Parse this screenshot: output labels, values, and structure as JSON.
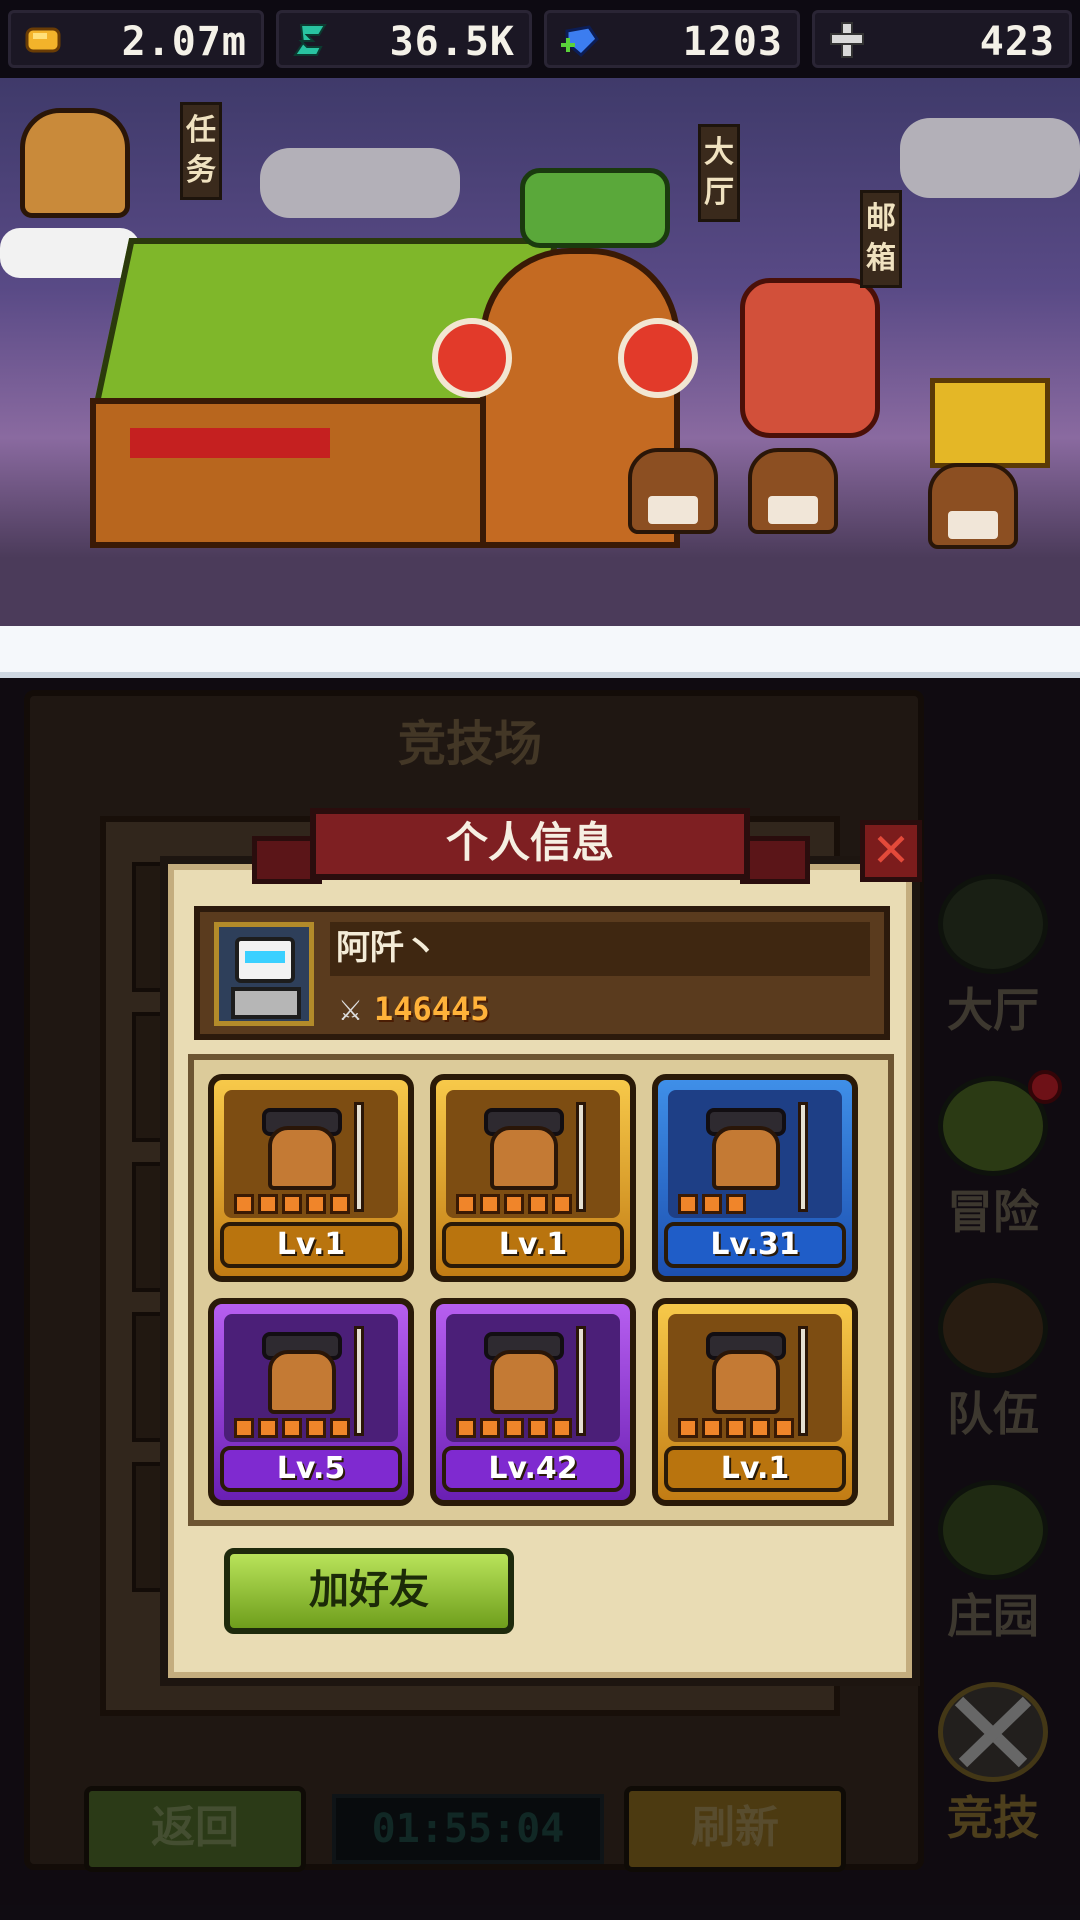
{
  "currencies": [
    {
      "name": "gold-coin-icon",
      "value": "2.07m",
      "color": "#f3b32a"
    },
    {
      "name": "energy-icon",
      "value": "36.5K",
      "color": "#29c3a1"
    },
    {
      "name": "gem-icon",
      "value": "1203",
      "color": "#3c7df0"
    },
    {
      "name": "cross-icon",
      "value": "423",
      "color": "#d9d9d9"
    }
  ],
  "town_signs": {
    "quest": "任务",
    "hall": "大厅",
    "mailbox": "邮箱"
  },
  "arena": {
    "title": "竞技场",
    "back_label": "返回",
    "timer": "01:55:04",
    "refresh_label": "刷新"
  },
  "side_nav": [
    {
      "label": "大厅",
      "icon": "hall-icon"
    },
    {
      "label": "冒险",
      "icon": "adventure-icon",
      "notify": true
    },
    {
      "label": "队伍",
      "icon": "team-icon"
    },
    {
      "label": "庄园",
      "icon": "manor-icon"
    },
    {
      "label": "竞技",
      "icon": "arena-swords-icon"
    }
  ],
  "dialog": {
    "title": "个人信息",
    "close_glyph": "✕",
    "player_name": "阿阡丶",
    "power_value": "146445",
    "add_friend_label": "加好友"
  },
  "heroes": [
    {
      "level": "Lv.1",
      "rarity": "gold",
      "stars": 5
    },
    {
      "level": "Lv.1",
      "rarity": "gold",
      "stars": 5
    },
    {
      "level": "Lv.31",
      "rarity": "blue",
      "stars": 3
    },
    {
      "level": "Lv.5",
      "rarity": "purple",
      "stars": 5
    },
    {
      "level": "Lv.42",
      "rarity": "purple",
      "stars": 5
    },
    {
      "level": "Lv.1",
      "rarity": "gold",
      "stars": 5
    }
  ]
}
